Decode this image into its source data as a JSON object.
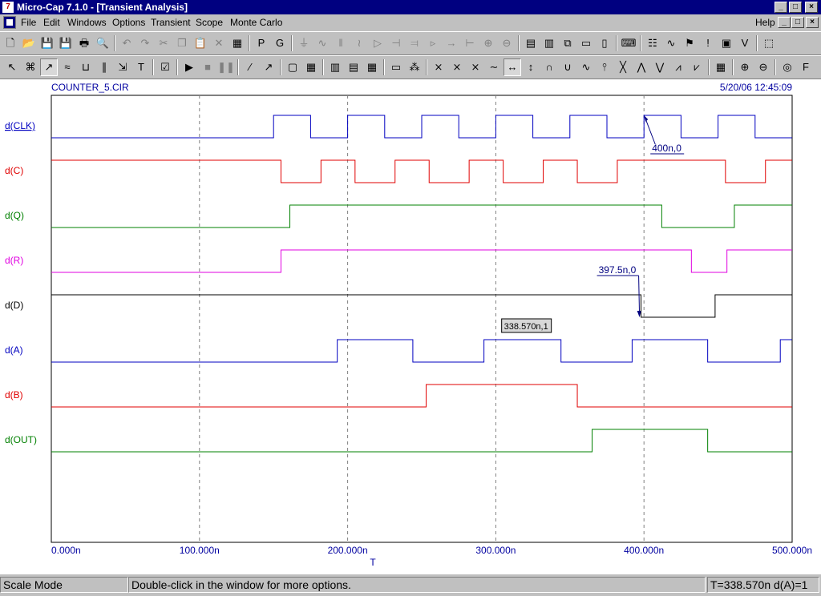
{
  "window": {
    "app_icon": "micro-cap-icon",
    "title": "Micro-Cap 7.1.0 - [Transient Analysis]",
    "caption_buttons": [
      "_",
      "□",
      "×"
    ]
  },
  "menu": {
    "items": [
      "File",
      "Edit",
      "Windows",
      "Options",
      "Transient",
      "Scope",
      "Monte Carlo"
    ],
    "help": "Help",
    "mdi_buttons": [
      "_",
      "□",
      "×"
    ]
  },
  "toolbar1": [
    {
      "name": "new-icon",
      "glyph": "🗋",
      "enabled": true
    },
    {
      "name": "open-icon",
      "glyph": "📂",
      "enabled": true
    },
    {
      "name": "save-icon",
      "glyph": "💾",
      "enabled": true
    },
    {
      "name": "save-all-icon",
      "glyph": "💾",
      "enabled": true
    },
    {
      "name": "print-icon",
      "glyph": "🖶",
      "enabled": true
    },
    {
      "name": "print-preview-icon",
      "glyph": "🔍",
      "enabled": true
    },
    {
      "sep": true
    },
    {
      "name": "undo-icon",
      "glyph": "↶",
      "enabled": false
    },
    {
      "name": "redo-icon",
      "glyph": "↷",
      "enabled": false
    },
    {
      "name": "cut-icon",
      "glyph": "✂",
      "enabled": false
    },
    {
      "name": "copy-icon",
      "glyph": "❐",
      "enabled": false
    },
    {
      "name": "paste-icon",
      "glyph": "📋",
      "enabled": false
    },
    {
      "name": "delete-icon",
      "glyph": "✕",
      "enabled": false
    },
    {
      "name": "select-all-icon",
      "glyph": "▦",
      "enabled": true
    },
    {
      "sep": true
    },
    {
      "name": "page-icon",
      "glyph": "P",
      "enabled": true
    },
    {
      "name": "grid-text-icon",
      "glyph": "G",
      "enabled": true
    },
    {
      "sep": true
    },
    {
      "name": "ground-icon",
      "glyph": "⏚",
      "enabled": false
    },
    {
      "name": "resistor-icon",
      "glyph": "∿",
      "enabled": false
    },
    {
      "name": "capacitor-icon",
      "glyph": "‖",
      "enabled": false
    },
    {
      "name": "inductor-icon",
      "glyph": "≀",
      "enabled": false
    },
    {
      "name": "diode-icon",
      "glyph": "▷",
      "enabled": false
    },
    {
      "name": "battery-icon",
      "glyph": "⊣",
      "enabled": false
    },
    {
      "name": "transistor-icon",
      "glyph": "⫤",
      "enabled": false
    },
    {
      "name": "opamp-icon",
      "glyph": "▹",
      "enabled": false
    },
    {
      "name": "switch-icon",
      "glyph": "→",
      "enabled": false
    },
    {
      "name": "jfet-icon",
      "glyph": "⊢",
      "enabled": false
    },
    {
      "name": "source-icon",
      "glyph": "⊕",
      "enabled": false
    },
    {
      "name": "isource-icon",
      "glyph": "⊖",
      "enabled": false
    },
    {
      "sep": true
    },
    {
      "name": "tile-horizontal-icon",
      "glyph": "▤",
      "enabled": true
    },
    {
      "name": "tile-vertical-icon",
      "glyph": "▥",
      "enabled": true
    },
    {
      "name": "cascade-icon",
      "glyph": "⧉",
      "enabled": true
    },
    {
      "name": "split-h-icon",
      "glyph": "▭",
      "enabled": true
    },
    {
      "name": "split-v-icon",
      "glyph": "▯",
      "enabled": true
    },
    {
      "sep": true
    },
    {
      "name": "calculator-icon",
      "glyph": "⌨",
      "enabled": true
    },
    {
      "sep": true
    },
    {
      "name": "component-list-icon",
      "glyph": "☷",
      "enabled": true
    },
    {
      "name": "waveform-icon",
      "glyph": "∿",
      "enabled": true
    },
    {
      "name": "probe-icon",
      "glyph": "⚑",
      "enabled": true
    },
    {
      "name": "info-icon",
      "glyph": "!",
      "enabled": true
    },
    {
      "name": "scope-icon",
      "glyph": "▣",
      "enabled": true
    },
    {
      "name": "vlimits-icon",
      "glyph": "V",
      "enabled": true
    },
    {
      "sep": true
    },
    {
      "name": "plot-properties-icon",
      "glyph": "⬚",
      "enabled": true
    }
  ],
  "toolbar2": [
    {
      "name": "select-arrow-icon",
      "glyph": "↖",
      "pressed": false
    },
    {
      "name": "point-mode-icon",
      "glyph": "⌘",
      "pressed": false
    },
    {
      "name": "scale-mode-icon",
      "glyph": "↗",
      "pressed": true
    },
    {
      "name": "cursor-mode-icon",
      "glyph": "≈",
      "pressed": false
    },
    {
      "name": "point-tag-icon",
      "glyph": "⊔",
      "pressed": false
    },
    {
      "name": "horizontal-tag-icon",
      "glyph": "∥",
      "pressed": false
    },
    {
      "name": "vertical-tag-icon",
      "glyph": "⇲",
      "pressed": false
    },
    {
      "name": "text-icon",
      "glyph": "T",
      "pressed": false
    },
    {
      "sep": true
    },
    {
      "name": "properties-icon",
      "glyph": "☑",
      "pressed": false
    },
    {
      "sep": true
    },
    {
      "name": "run-icon",
      "glyph": "▶",
      "pressed": false
    },
    {
      "name": "stop-icon",
      "glyph": "■",
      "pressed": false,
      "disabled": true
    },
    {
      "name": "pause-icon",
      "glyph": "❚❚",
      "pressed": false,
      "disabled": true
    },
    {
      "sep": true
    },
    {
      "name": "line-icon",
      "glyph": "∕",
      "pressed": false
    },
    {
      "name": "arrow-line-icon",
      "glyph": "↗",
      "pressed": false
    },
    {
      "sep": true
    },
    {
      "name": "box-icon",
      "glyph": "▢",
      "pressed": false
    },
    {
      "name": "grid-icon",
      "glyph": "▦",
      "pressed": false
    },
    {
      "sep": true
    },
    {
      "name": "minor-grid-icon",
      "glyph": "▥",
      "pressed": false
    },
    {
      "name": "major-grid-icon",
      "glyph": "▤",
      "pressed": false
    },
    {
      "name": "axis-grid-icon",
      "glyph": "▦",
      "pressed": false
    },
    {
      "sep": true
    },
    {
      "name": "data-points-icon",
      "glyph": "▭",
      "pressed": false
    },
    {
      "name": "tokens-icon",
      "glyph": "⁂",
      "pressed": false
    },
    {
      "sep": true
    },
    {
      "name": "next-simulation-icon",
      "glyph": "⨯",
      "pressed": false
    },
    {
      "name": "prev-simulation-icon",
      "glyph": "⨯",
      "pressed": false
    },
    {
      "name": "next-point-icon",
      "glyph": "⨯",
      "pressed": false
    },
    {
      "name": "prev-point-icon",
      "glyph": "∼",
      "pressed": false
    },
    {
      "name": "peak-icon",
      "glyph": "↔",
      "pressed": true
    },
    {
      "name": "valley-icon",
      "glyph": "↕",
      "pressed": false
    },
    {
      "name": "high-icon",
      "glyph": "∩",
      "pressed": false
    },
    {
      "name": "low-icon",
      "glyph": "∪",
      "pressed": false
    },
    {
      "name": "inflection-icon",
      "glyph": "∿",
      "pressed": false
    },
    {
      "name": "global-high-icon",
      "glyph": "⫯",
      "pressed": false
    },
    {
      "name": "global-low-icon",
      "glyph": "╳",
      "pressed": false
    },
    {
      "name": "top-icon",
      "glyph": "⋀",
      "pressed": false
    },
    {
      "name": "bottom-icon",
      "glyph": "⋁",
      "pressed": false
    },
    {
      "name": "slope-icon",
      "glyph": "⩘",
      "pressed": false
    },
    {
      "name": "distance-icon",
      "glyph": "⩗",
      "pressed": false
    },
    {
      "sep": true
    },
    {
      "name": "numeric-output-icon",
      "glyph": "▦",
      "pressed": false
    },
    {
      "sep": true
    },
    {
      "name": "zoom-in-icon",
      "glyph": "⊕",
      "pressed": false
    },
    {
      "name": "zoom-out-icon",
      "glyph": "⊖",
      "pressed": false
    },
    {
      "sep": true
    },
    {
      "name": "fft-icon",
      "glyph": "◎",
      "pressed": false
    },
    {
      "name": "font-icon",
      "glyph": "F",
      "pressed": false
    }
  ],
  "plot": {
    "circuit_name": "COUNTER_5.CIR",
    "timestamp": "5/20/06 12:45:09",
    "x_axis_label": "T",
    "x_tick_labels": [
      "0.000n",
      "100.000n",
      "200.000n",
      "300.000n",
      "400.000n",
      "500.000n"
    ],
    "x_range_ns": [
      0,
      500
    ],
    "grid_color": "#808080",
    "traces": [
      {
        "label": "d(CLK)",
        "color": "#0000c0",
        "underline": true,
        "initial": 0,
        "edges_ns": [
          150,
          175,
          200,
          225,
          250,
          275,
          300,
          325,
          350,
          375,
          400,
          425,
          450,
          475
        ]
      },
      {
        "label": "d(C)",
        "color": "#e00000",
        "underline": false,
        "initial": 1,
        "edges_ns": [
          155,
          182,
          205,
          232,
          255,
          282,
          305,
          332,
          355,
          382,
          455,
          482
        ]
      },
      {
        "label": "d(Q)",
        "color": "#008000",
        "underline": false,
        "initial": 0,
        "edges_ns": [
          161,
          412,
          461
        ]
      },
      {
        "label": "d(R)",
        "color": "#e000e0",
        "underline": false,
        "initial": 0,
        "edges_ns": [
          155,
          432,
          456
        ]
      },
      {
        "label": "d(D)",
        "color": "#000000",
        "underline": false,
        "initial": 1,
        "edges_ns": [
          398,
          448
        ]
      },
      {
        "label": "d(A)",
        "color": "#0000c0",
        "underline": false,
        "initial": 0,
        "edges_ns": [
          193,
          244,
          292,
          344,
          392,
          443,
          492
        ]
      },
      {
        "label": "d(B)",
        "color": "#e00000",
        "underline": false,
        "initial": 0,
        "edges_ns": [
          253,
          355
        ]
      },
      {
        "label": "d(OUT)",
        "color": "#008000",
        "underline": false,
        "initial": 0,
        "edges_ns": [
          365,
          443
        ]
      }
    ],
    "annotations": [
      {
        "text": "400n,0",
        "trace": 0,
        "at_ns": 400,
        "level": 1,
        "boxed": false
      },
      {
        "text": "397.5n,0",
        "trace": 4,
        "at_ns": 397.5,
        "level": 0,
        "boxed": false
      },
      {
        "text": "338.570n,1",
        "trace": 5,
        "at_ns": 338.57,
        "level": 1,
        "boxed": true
      }
    ]
  },
  "status": {
    "mode": "Scale Mode",
    "hint": "Double-click in the window for more options.",
    "readout": "T=338.570n d(A)=1"
  }
}
